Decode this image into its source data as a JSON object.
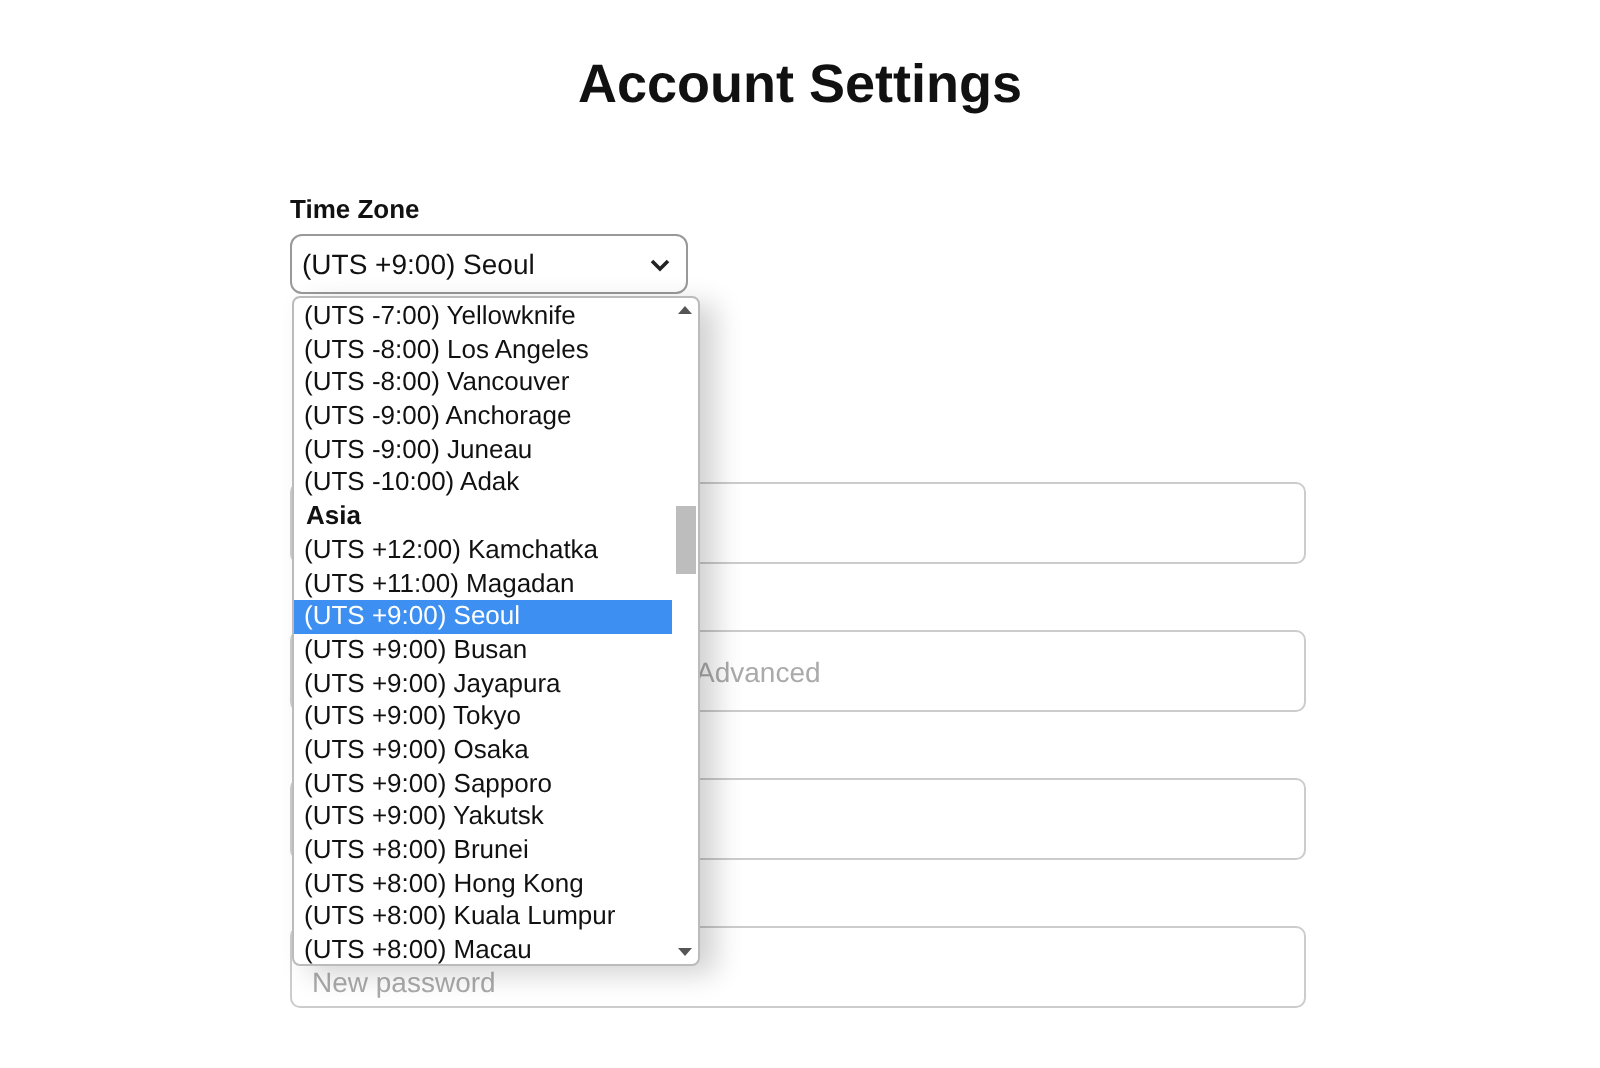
{
  "title": "Account Settings",
  "time_zone": {
    "label": "Time Zone",
    "value": "(UTS +9:00) Seoul",
    "expanded": true,
    "options": [
      {
        "kind": "option",
        "label": "(UTS -7:00) Yellowknife",
        "selected": false
      },
      {
        "kind": "option",
        "label": "(UTS -8:00) Los Angeles",
        "selected": false
      },
      {
        "kind": "option",
        "label": "(UTS -8:00) Vancouver",
        "selected": false
      },
      {
        "kind": "option",
        "label": "(UTS -9:00) Anchorage",
        "selected": false
      },
      {
        "kind": "option",
        "label": "(UTS -9:00) Juneau",
        "selected": false
      },
      {
        "kind": "option",
        "label": "(UTS -10:00) Adak",
        "selected": false
      },
      {
        "kind": "group",
        "label": "Asia"
      },
      {
        "kind": "option",
        "label": "(UTS +12:00) Kamchatka",
        "selected": false
      },
      {
        "kind": "option",
        "label": "(UTS +11:00) Magadan",
        "selected": false
      },
      {
        "kind": "option",
        "label": "(UTS +9:00) Seoul",
        "selected": true
      },
      {
        "kind": "option",
        "label": "(UTS +9:00) Busan",
        "selected": false
      },
      {
        "kind": "option",
        "label": "(UTS +9:00) Jayapura",
        "selected": false
      },
      {
        "kind": "option",
        "label": "(UTS +9:00) Tokyo",
        "selected": false
      },
      {
        "kind": "option",
        "label": "(UTS +9:00) Osaka",
        "selected": false
      },
      {
        "kind": "option",
        "label": "(UTS +9:00) Sapporo",
        "selected": false
      },
      {
        "kind": "option",
        "label": "(UTS +9:00) Yakutsk",
        "selected": false
      },
      {
        "kind": "option",
        "label": "(UTS +8:00) Brunei",
        "selected": false
      },
      {
        "kind": "option",
        "label": "(UTS +8:00) Hong Kong",
        "selected": false
      },
      {
        "kind": "option",
        "label": "(UTS +8:00) Kuala Lumpur",
        "selected": false
      },
      {
        "kind": "option",
        "label": "(UTS +8:00) Macau",
        "selected": false
      }
    ]
  },
  "fields": [
    {
      "kind": "plain"
    },
    {
      "kind": "shifted",
      "placeholder": "Advanced"
    },
    {
      "kind": "plain"
    },
    {
      "kind": "low",
      "placeholder": "New password"
    }
  ]
}
